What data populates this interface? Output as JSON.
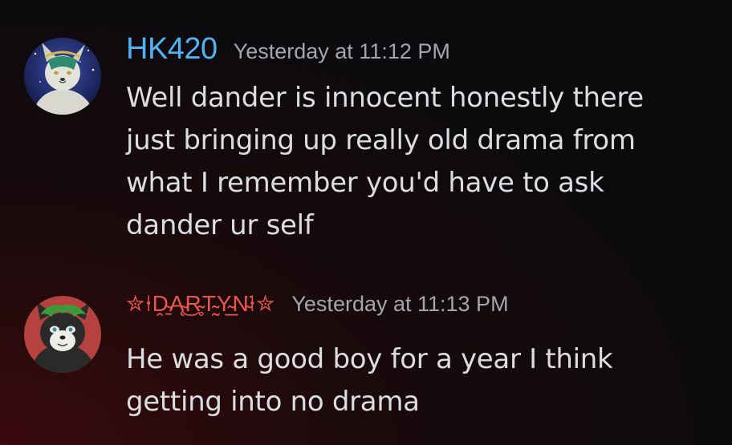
{
  "messages": [
    {
      "author": "HK420",
      "timestamp": "Yesterday at 11:12 PM",
      "text": "Well dander is innocent honestly there just bringing up really old drama from what I remember you'd have to ask dander ur self",
      "name_color": "#4fb3f5",
      "avatar": "wolf-avatar-icon"
    },
    {
      "author": "✮ꝉ𝔻𝔸ℝ𝕋𝕐ℕꝉ✮",
      "author_display": "✮⍿Ḓ̴̱Ą̴͜R̴̥T̴̰Y̴̲N̴̈⍿✮",
      "timestamp": "Yesterday at 11:13 PM",
      "text": "He was a good boy for a year I think getting into no drama",
      "name_color": "#e8554a",
      "avatar": "raccoon-avatar-icon"
    }
  ]
}
